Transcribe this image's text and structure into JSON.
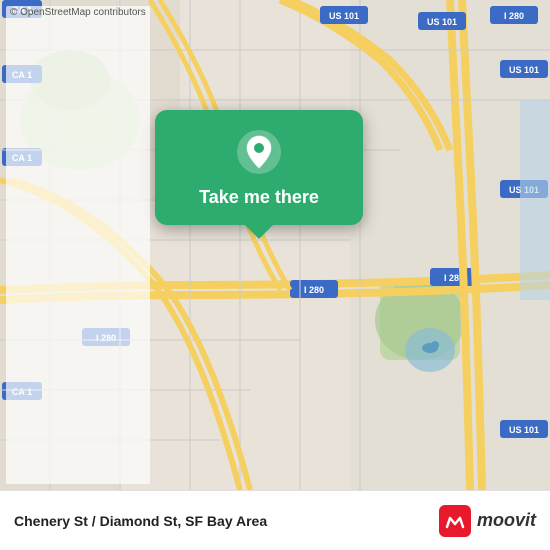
{
  "map": {
    "alt": "OpenStreetMap of Chenery St / Diamond St, SF Bay Area"
  },
  "card": {
    "label": "Take me there",
    "pin_icon": "location-pin"
  },
  "bottom_bar": {
    "copyright": "© OpenStreetMap contributors",
    "location": "Chenery St / Diamond St, SF Bay Area",
    "moovit_text": "moovit"
  }
}
